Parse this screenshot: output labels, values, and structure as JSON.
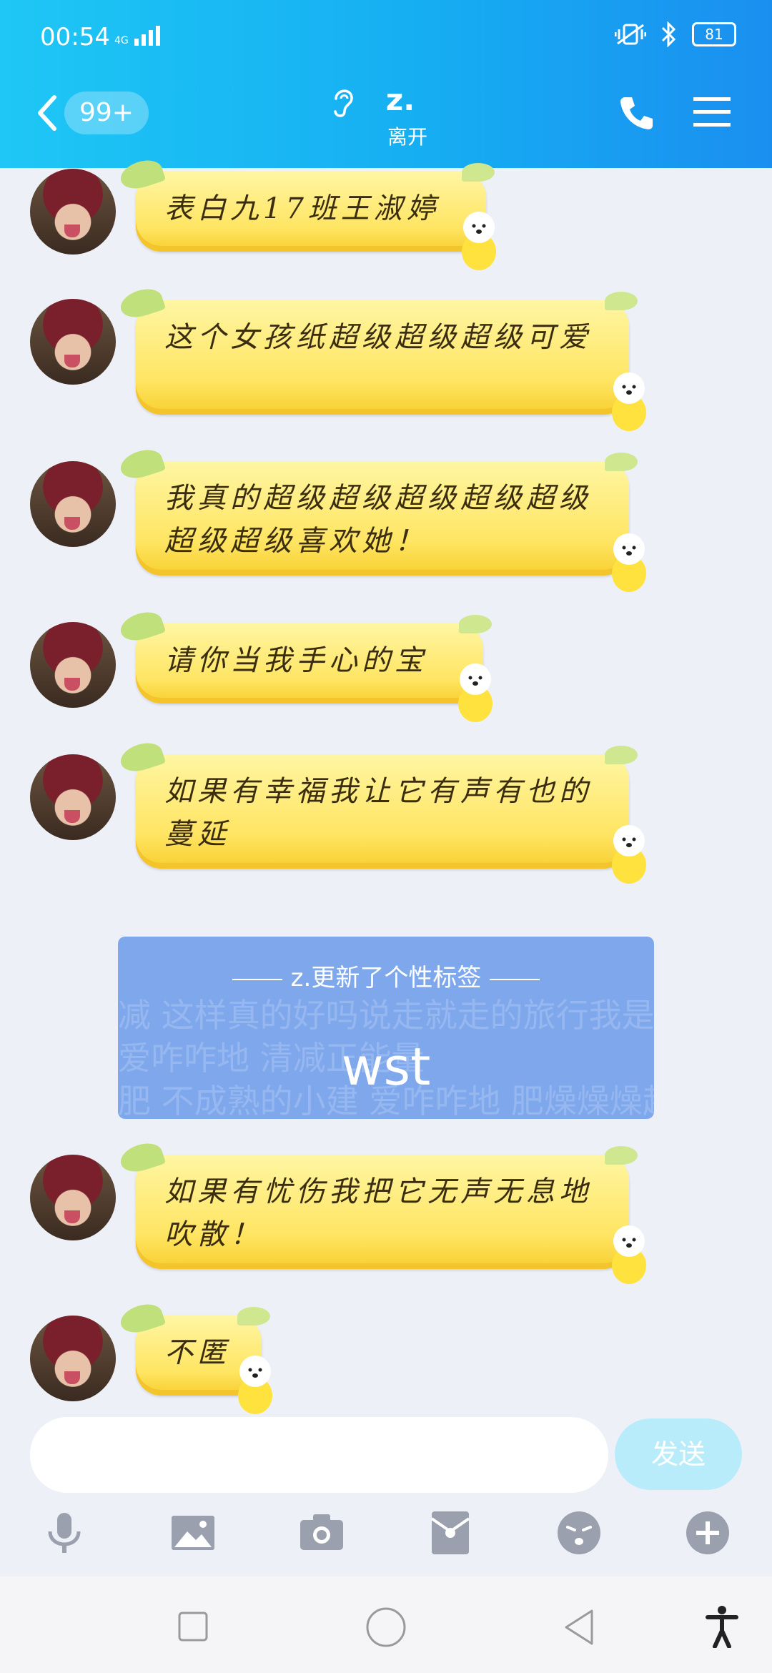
{
  "status_bar": {
    "time": "00:54",
    "network": "4G",
    "battery": "81"
  },
  "header": {
    "unread_badge": "99+",
    "contact_name": "z.",
    "contact_status": "离开"
  },
  "messages": [
    {
      "text": "表白九17班王淑婷"
    },
    {
      "text": "这个女孩纸超级超级超级可爱"
    },
    {
      "text": "我真的超级超级超级超级超级超级超级喜欢她！"
    },
    {
      "text": "请你当我手心的宝"
    },
    {
      "text": "如果有幸福我让它有声有也的蔓延"
    },
    {
      "text": "如果有忧伤我把它无声无息地吹散！"
    },
    {
      "text": "不匿"
    }
  ],
  "signature_card": {
    "header": "z.更新了个性标签",
    "text": "wst",
    "background_text": [
      "减 这样真的好吗说走就走的旅行我是过来人 哦",
      "爱咋咋地 清减正能量",
      "肥 不成熟的小建 爱咋咋地 肥燥燥燥起来"
    ]
  },
  "composer": {
    "placeholder": "",
    "send_label": "发送"
  },
  "toolbar": [
    "microphone-icon",
    "image-icon",
    "camera-icon",
    "red-packet-icon",
    "emoji-icon",
    "plus-icon"
  ],
  "colors": {
    "header_start": "#1ec7f5",
    "header_end": "#1a8ff0",
    "bubble": "#ffe563",
    "send_button": "#b9ecfb",
    "card": "#7fa8ec"
  }
}
